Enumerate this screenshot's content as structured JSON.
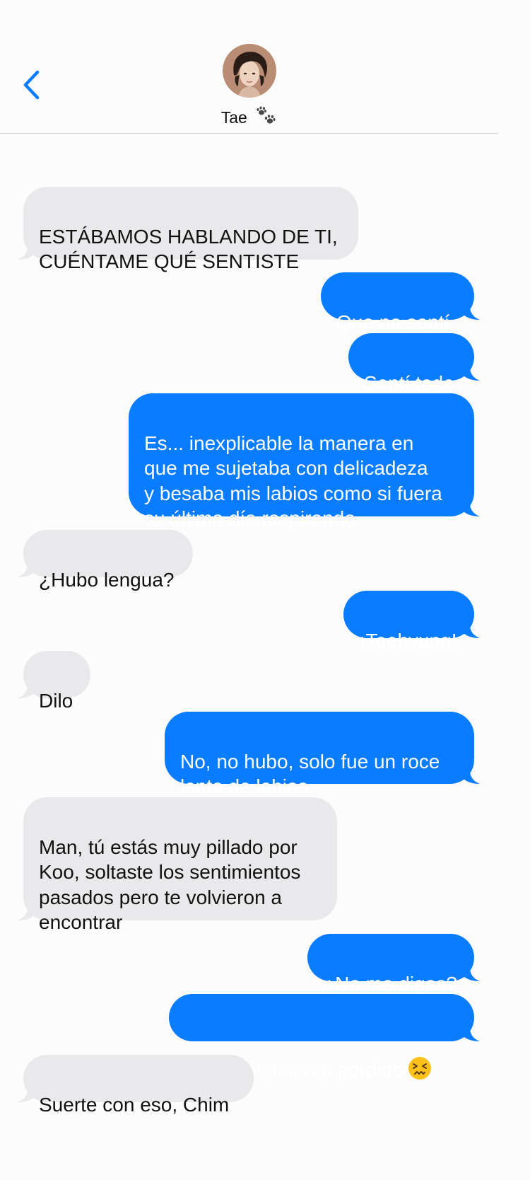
{
  "header": {
    "back_label": "Back",
    "contact_name": "Tae",
    "name_emoji": "paw-prints-icon"
  },
  "colors": {
    "incoming_bubble": "#e9e9eb",
    "outgoing_bubble": "#0a7cff",
    "back_chevron": "#0a7cff"
  },
  "messages": [
    {
      "direction": "incoming",
      "text": "ESTÁBAMOS HABLANDO DE TI,\nCUÉNTAME QUÉ SENTISTE"
    },
    {
      "direction": "outgoing",
      "text": "Que no sentí"
    },
    {
      "direction": "outgoing",
      "text": "Sentí todo"
    },
    {
      "direction": "outgoing",
      "text": "Es... inexplicable la manera en\nque me sujetaba con delicadeza\ny besaba mis labios como si fuera\nsu última día respirando"
    },
    {
      "direction": "incoming",
      "text": "¿Hubo lengua?"
    },
    {
      "direction": "outgoing",
      "text": "¡Taehyung!"
    },
    {
      "direction": "incoming",
      "text": "Dilo"
    },
    {
      "direction": "outgoing",
      "text": "No, no hubo, solo fue un roce\nlento de labios"
    },
    {
      "direction": "incoming",
      "text": "Man, tú estás muy pillado por\nKoo, soltaste los sentimientos\npasados pero te volvieron a\nencontrar"
    },
    {
      "direction": "outgoing",
      "text": "¿No me digas?"
    },
    {
      "direction": "outgoing",
      "text": "Estoy totalmente perdido",
      "emoji": "confounded-face-icon"
    },
    {
      "direction": "incoming",
      "text": "Suerte con eso, Chim"
    }
  ]
}
